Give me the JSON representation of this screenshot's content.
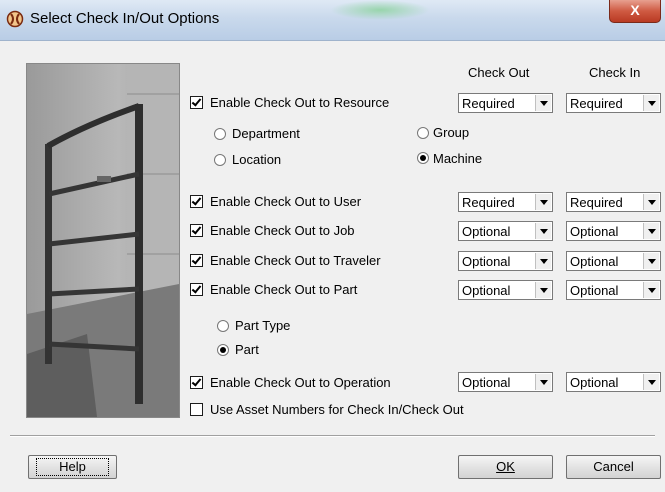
{
  "window": {
    "title": "Select Check In/Out Options",
    "close_label": "X"
  },
  "headers": {
    "check_out": "Check Out",
    "check_in": "Check In"
  },
  "options": {
    "resource": {
      "label": "Enable Check Out to Resource",
      "checked": true,
      "check_out": "Required",
      "check_in": "Required"
    },
    "user": {
      "label": "Enable Check Out to User",
      "checked": true,
      "check_out": "Required",
      "check_in": "Required"
    },
    "job": {
      "label": "Enable Check Out to Job",
      "checked": true,
      "check_out": "Optional",
      "check_in": "Optional"
    },
    "traveler": {
      "label": "Enable Check Out to Traveler",
      "checked": true,
      "check_out": "Optional",
      "check_in": "Optional"
    },
    "part": {
      "label": "Enable Check Out to Part",
      "checked": true,
      "check_out": "Optional",
      "check_in": "Optional"
    },
    "operation": {
      "label": "Enable Check Out to Operation",
      "checked": true,
      "check_out": "Optional",
      "check_in": "Optional"
    },
    "asset": {
      "label": "Use Asset Numbers for Check In/Check Out",
      "checked": false
    }
  },
  "resource_types": {
    "department": "Department",
    "group": "Group",
    "location": "Location",
    "machine": "Machine",
    "selected": "Machine"
  },
  "part_types": {
    "part_type": "Part Type",
    "part": "Part",
    "selected": "Part"
  },
  "buttons": {
    "help": "Help",
    "ok": "OK",
    "cancel": "Cancel"
  }
}
